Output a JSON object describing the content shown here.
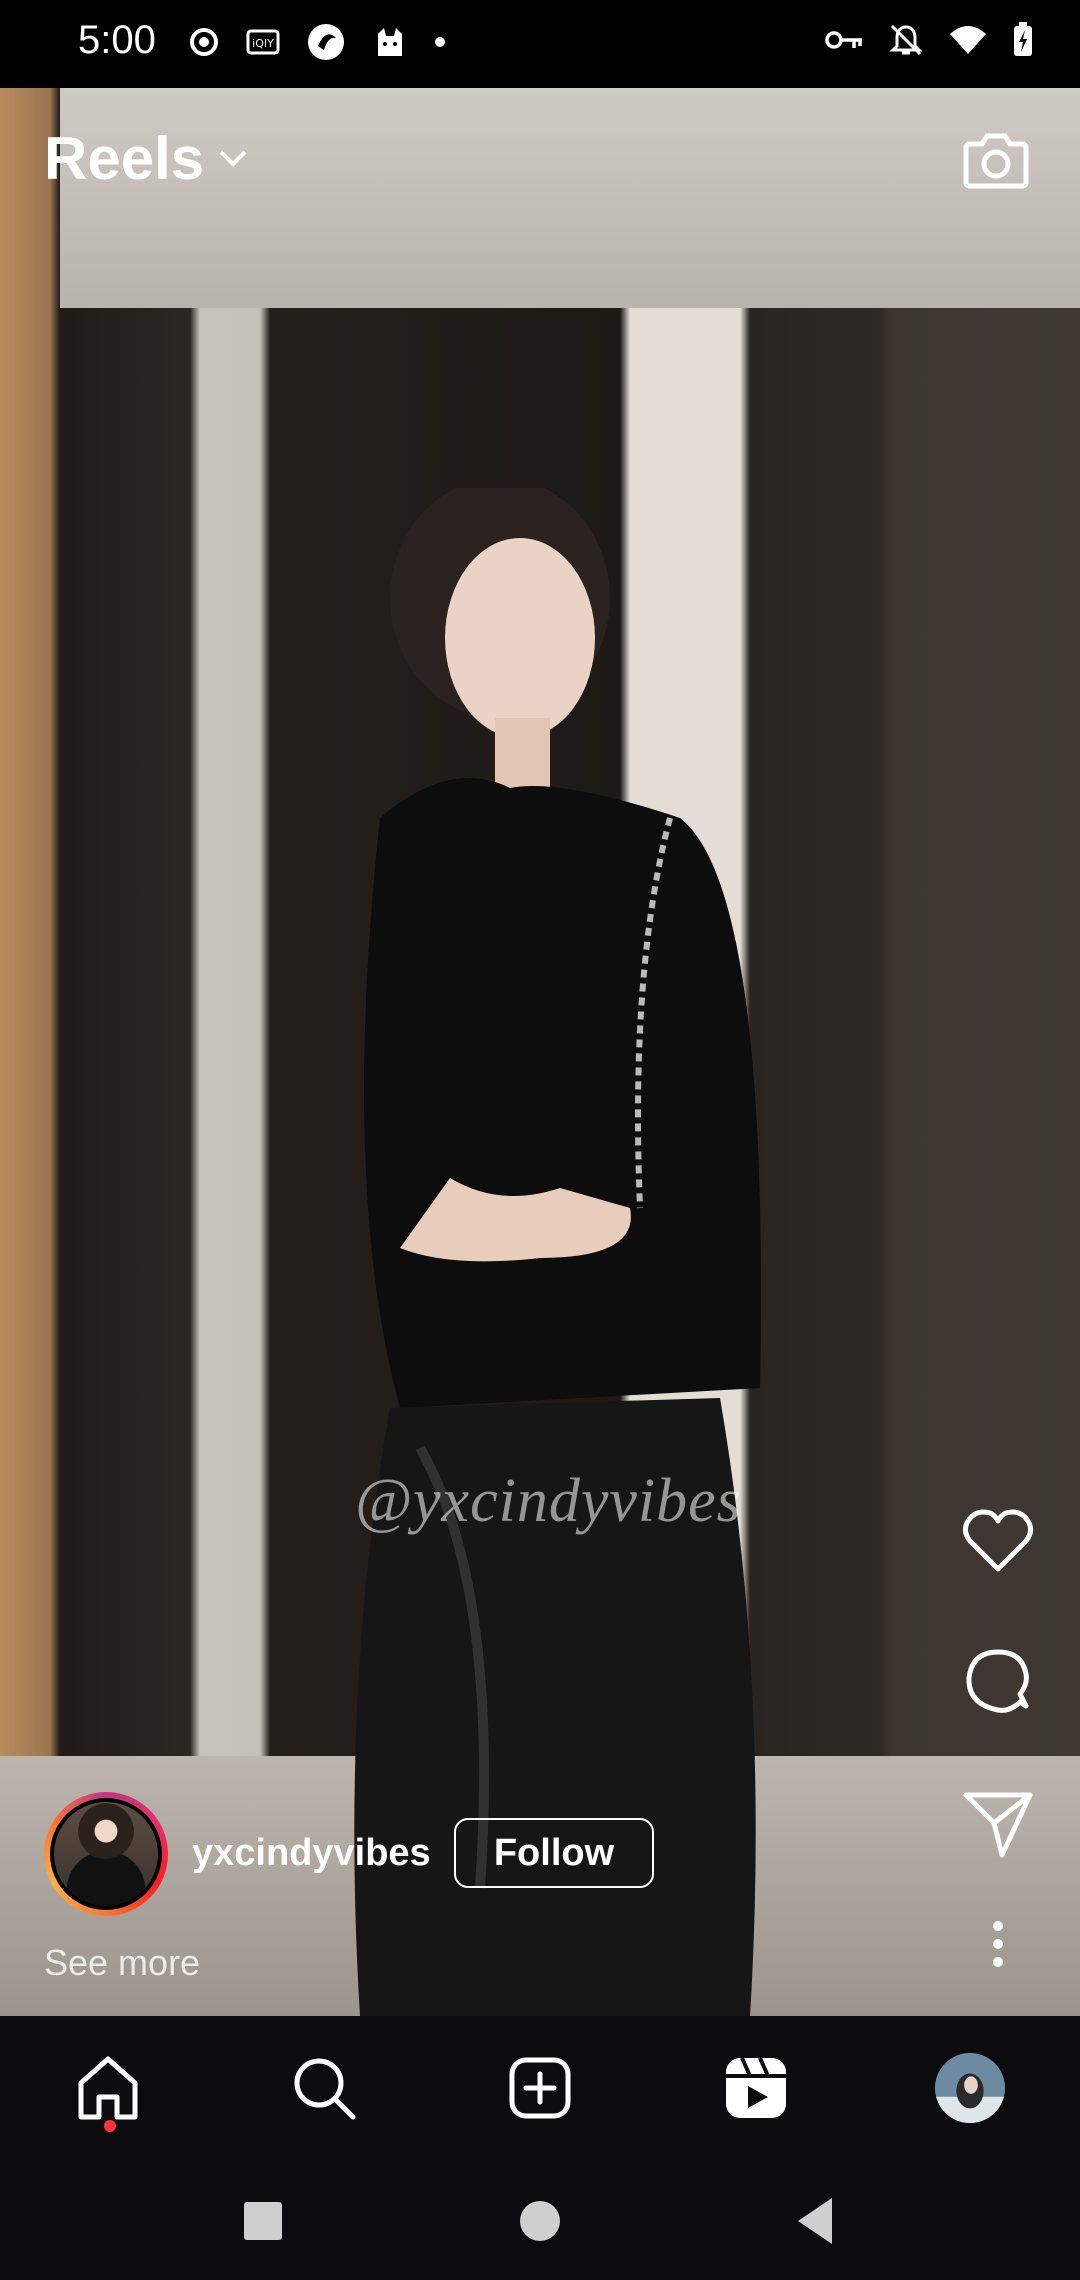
{
  "status_bar": {
    "time": "5:00",
    "left_icons": [
      "record-icon",
      "iqiyi-icon",
      "app-circle-icon",
      "cat-app-icon",
      "dot-icon"
    ],
    "right_icons": [
      "key-icon",
      "bell-off-icon",
      "wifi-icon",
      "battery-charging-icon"
    ]
  },
  "header": {
    "title": "Reels",
    "dropdown_icon": "chevron-down-icon",
    "camera_icon": "camera-icon"
  },
  "video": {
    "watermark": "@yxcindyvibes"
  },
  "actions": [
    "heart-icon",
    "comment-icon",
    "share-send-icon",
    "more-vertical-icon"
  ],
  "reel_info": {
    "username": "yxcindyvibes",
    "follow_label": "Follow",
    "see_more": "See more"
  },
  "bottom_nav": [
    "home-icon",
    "search-icon",
    "add-post-icon",
    "reels-icon",
    "profile-avatar"
  ],
  "system_nav": [
    "recents-square",
    "home-circle",
    "back-triangle"
  ],
  "colors": {
    "background": "#000000",
    "nav_background": "#0c0c0f",
    "notification_dot": "#ff3040"
  }
}
